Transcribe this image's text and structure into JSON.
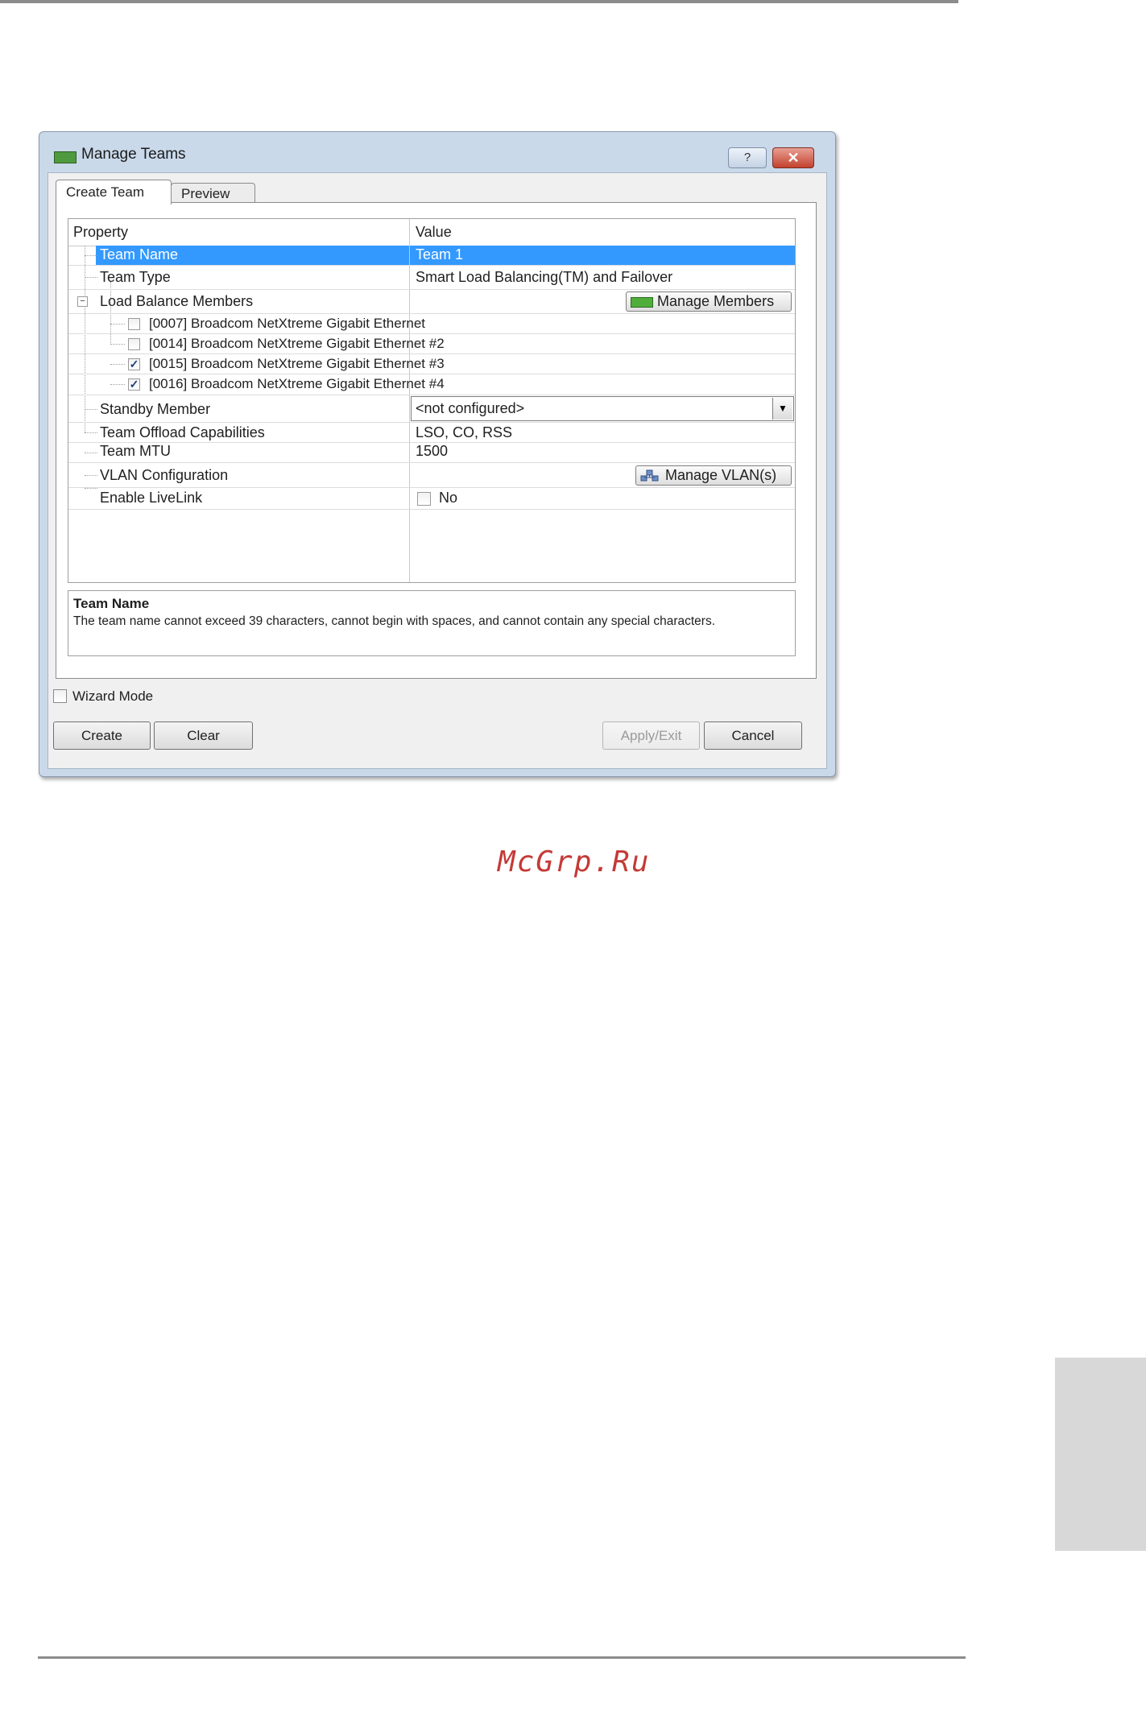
{
  "watermark": "McGrp.Ru",
  "dialog": {
    "title": "Manage Teams",
    "help_symbol": "?",
    "close_symbol": "✕",
    "tabs": [
      {
        "label": "Create Team",
        "active": true
      },
      {
        "label": "Preview",
        "active": false
      }
    ],
    "grid": {
      "headers": {
        "property": "Property",
        "value": "Value"
      },
      "team_name": {
        "label": "Team Name",
        "value": "Team 1"
      },
      "team_type": {
        "label": "Team Type",
        "value": "Smart Load Balancing(TM) and Failover"
      },
      "load_balance": {
        "label": "Load Balance Members",
        "button": "Manage Members"
      },
      "members": [
        {
          "label": "[0007] Broadcom NetXtreme Gigabit Ethernet",
          "checked": false
        },
        {
          "label": "[0014] Broadcom NetXtreme Gigabit Ethernet #2",
          "checked": false
        },
        {
          "label": "[0015] Broadcom NetXtreme Gigabit Ethernet #3",
          "checked": true
        },
        {
          "label": "[0016] Broadcom NetXtreme Gigabit Ethernet #4",
          "checked": true
        }
      ],
      "standby": {
        "label": "Standby Member",
        "value": "<not configured>"
      },
      "offload": {
        "label": "Team Offload Capabilities",
        "value": "LSO, CO, RSS"
      },
      "mtu": {
        "label": "Team MTU",
        "value": "1500"
      },
      "vlan": {
        "label": "VLAN Configuration",
        "button": "Manage VLAN(s)"
      },
      "livelink": {
        "label": "Enable LiveLink",
        "value": "No",
        "checked": false
      }
    },
    "description": {
      "title": "Team Name",
      "body": "The team name cannot exceed 39 characters, cannot begin with spaces, and cannot contain any special characters."
    },
    "wizard_mode": {
      "label": "Wizard Mode",
      "checked": false
    },
    "buttons": {
      "create": "Create",
      "clear": "Clear",
      "apply_exit": "Apply/Exit",
      "cancel": "Cancel"
    }
  },
  "colors": {
    "selection": "#3399ff",
    "window_frame": "#c9d9ea",
    "watermark": "#c43a36"
  }
}
